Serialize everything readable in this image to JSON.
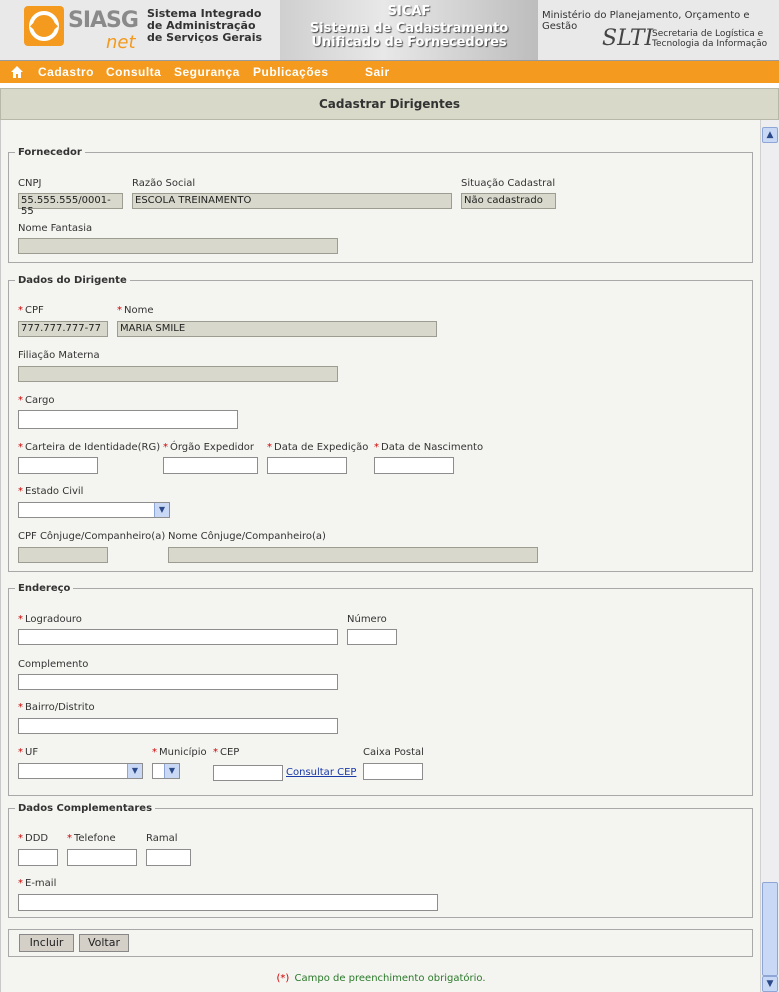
{
  "header": {
    "logo_word": "SIASG",
    "logo_net": "net",
    "system_name": "Sistema Integrado de Administração de Serviços Gerais",
    "banner_title": "SICAF",
    "banner_subtitle": "Sistema de Cadastramento Unificado de Fornecedores",
    "ministry": "Ministério do Planejamento, Orçamento e Gestão",
    "slti_logo": "SLTI",
    "slti_text": "Secretaria de Logística e Tecnologia da Informação"
  },
  "menu": {
    "items": [
      "Cadastro",
      "Consulta",
      "Segurança",
      "Publicações",
      "Sair"
    ]
  },
  "page_title": "Cadastrar Dirigentes",
  "fornecedor": {
    "legend": "Fornecedor",
    "cnpj_label": "CNPJ",
    "cnpj_value": "55.555.555/0001-55",
    "razao_label": "Razão Social",
    "razao_value": "ESCOLA TREINAMENTO",
    "situacao_label": "Situação Cadastral",
    "situacao_value": "Não cadastrado",
    "fantasia_label": "Nome Fantasia",
    "fantasia_value": ""
  },
  "dirigente": {
    "legend": "Dados do Dirigente",
    "cpf_label": "CPF",
    "cpf_value": "777.777.777-77",
    "nome_label": "Nome",
    "nome_value": "MARIA SMILE",
    "filiacao_label": "Filiação Materna",
    "cargo_label": "Cargo",
    "rg_label": "Carteira de Identidade(RG)",
    "orgao_label": "Órgão Expedidor",
    "data_exp_label": "Data de Expedição",
    "data_nasc_label": "Data de Nascimento",
    "estado_civil_label": "Estado Civil",
    "cpf_conjuge_label": "CPF Cônjuge/Companheiro(a)",
    "nome_conjuge_label": "Nome Cônjuge/Companheiro(a)"
  },
  "endereco": {
    "legend": "Endereço",
    "logradouro_label": "Logradouro",
    "numero_label": "Número",
    "complemento_label": "Complemento",
    "bairro_label": "Bairro/Distrito",
    "uf_label": "UF",
    "municipio_label": "Município",
    "cep_label": "CEP",
    "consultar_cep": "Consultar CEP",
    "caixa_postal_label": "Caixa Postal"
  },
  "complementares": {
    "legend": "Dados Complementares",
    "ddd_label": "DDD",
    "telefone_label": "Telefone",
    "ramal_label": "Ramal",
    "email_label": "E-mail"
  },
  "buttons": {
    "incluir": "Incluir",
    "voltar": "Voltar"
  },
  "required_marker": "*",
  "footnote_marker": "(*)",
  "footnote_text": " Campo de preenchimento obrigatório.",
  "colors": {
    "menu_bar": "#f39a1f",
    "title_bar": "#d9d9c9",
    "required": "#cc0000",
    "readonly_field": "#d8d8cc",
    "link": "#1a3aa8",
    "footnote": "#2a7a2a"
  }
}
